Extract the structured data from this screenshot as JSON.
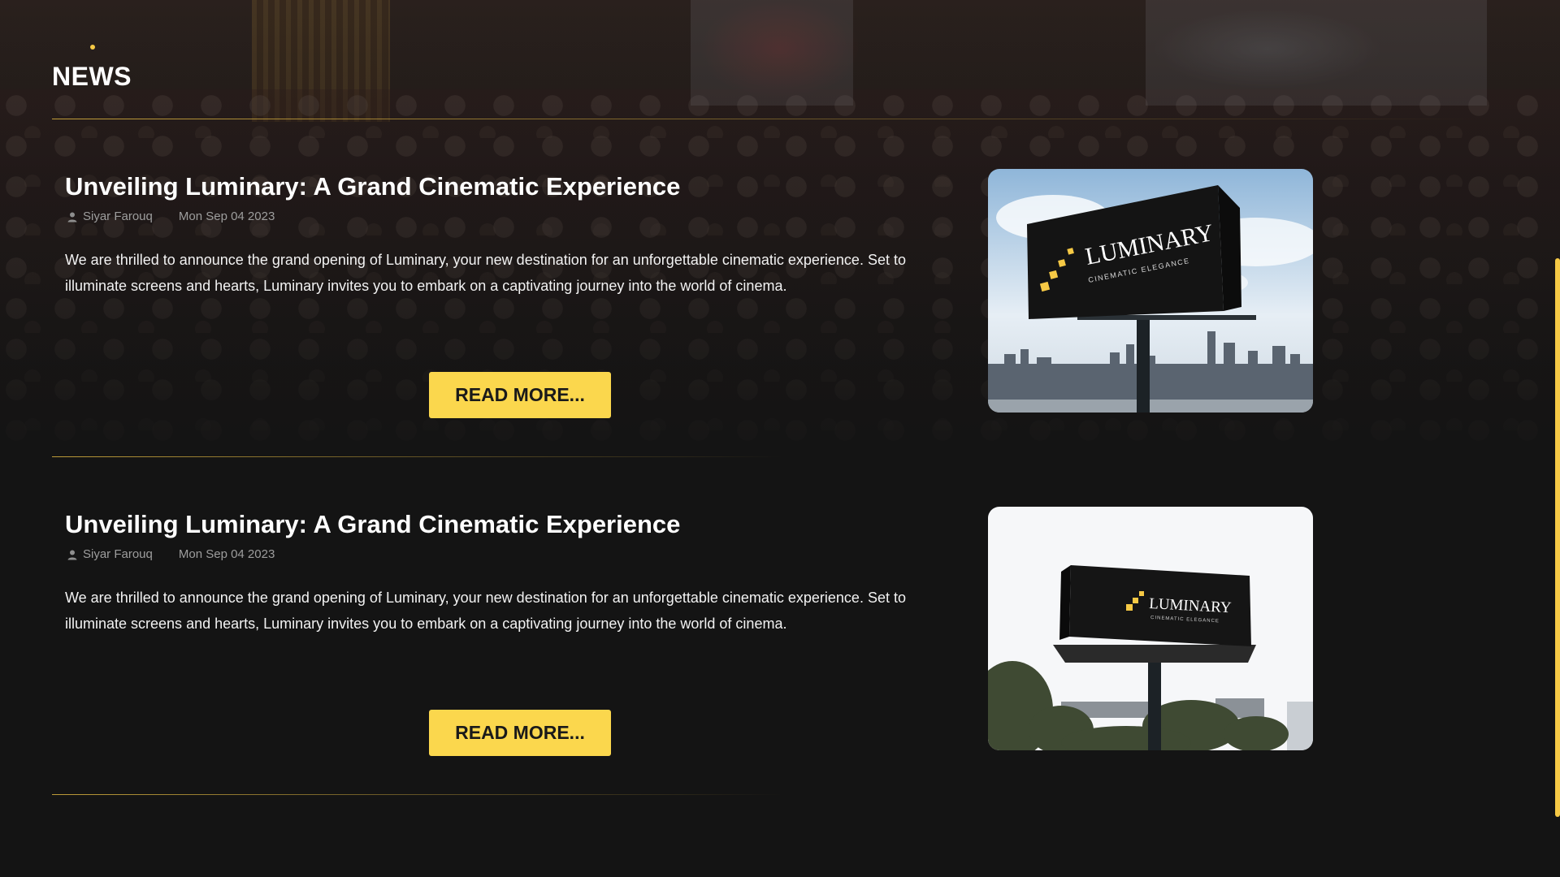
{
  "section": {
    "title": "NEWS"
  },
  "news": [
    {
      "title": "Unveiling Luminary: A Grand Cinematic Experience",
      "author": "Siyar Farouq",
      "date": "Mon Sep 04 2023",
      "excerpt": "We are thrilled to announce the grand opening of Luminary, your new destination for an unforgettable cinematic experience. Set to illuminate screens and hearts, Luminary invites you to embark on a captivating journey into the world of cinema.",
      "button": "READ MORE...",
      "image": {
        "brand": "LUMINARY",
        "tagline": "CINEMATIC ELEGANCE"
      }
    },
    {
      "title": "Unveiling Luminary: A Grand Cinematic Experience",
      "author": "Siyar Farouq",
      "date": "Mon Sep 04 2023",
      "excerpt": "We are thrilled to announce the grand opening of Luminary, your new destination for an unforgettable cinematic experience. Set to illuminate screens and hearts, Luminary invites you to embark on a captivating journey into the world of cinema.",
      "button": "READ MORE...",
      "image": {
        "brand": "LUMINARY",
        "tagline": "CINEMATIC ELEGANCE"
      }
    }
  ],
  "colors": {
    "accent": "#fbd74d",
    "background": "#141414",
    "meta": "#9d9d9d"
  },
  "icons": {
    "author": "user-icon"
  }
}
